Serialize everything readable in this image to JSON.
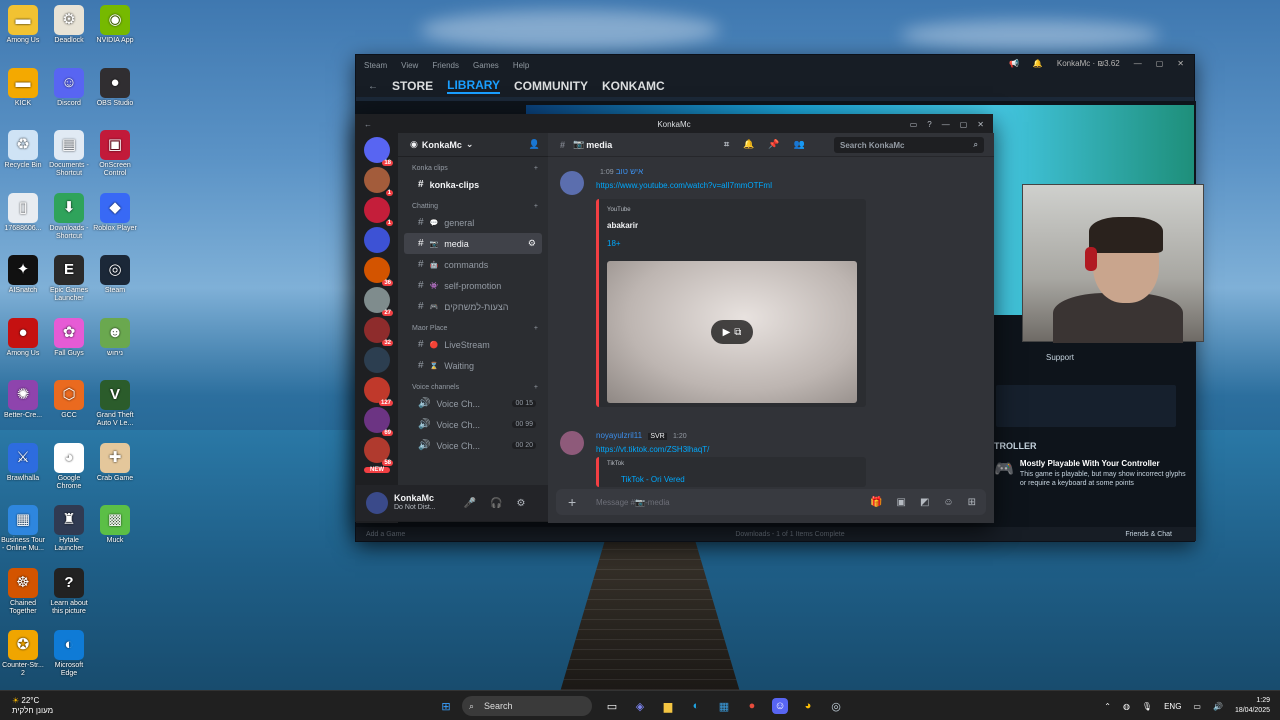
{
  "desktop": {
    "icons": [
      {
        "label": "Among Us",
        "color": "#f1c232",
        "glyph": "▬",
        "col": 0,
        "row": 0
      },
      {
        "label": "Deadlock",
        "color": "#e8e3d6",
        "glyph": "⚙",
        "col": 1,
        "row": 0
      },
      {
        "label": "NVIDIA App",
        "color": "#76b900",
        "glyph": "◉",
        "col": 2,
        "row": 0
      },
      {
        "label": "KICK",
        "color": "#f4a900",
        "glyph": "▬",
        "col": 0,
        "row": 1
      },
      {
        "label": "Discord",
        "color": "#5865f2",
        "glyph": "☺",
        "col": 1,
        "row": 1
      },
      {
        "label": "OBS Studio",
        "color": "#302e31",
        "glyph": "●",
        "col": 2,
        "row": 1
      },
      {
        "label": "Recycle Bin",
        "color": "#cfe3f5",
        "glyph": "♻",
        "col": 0,
        "row": 2
      },
      {
        "label": "Documents - Shortcut",
        "color": "#e1eaf4",
        "glyph": "▤",
        "col": 1,
        "row": 2
      },
      {
        "label": "OnScreen Control",
        "color": "#c21a3a",
        "glyph": "▣",
        "col": 2,
        "row": 2
      },
      {
        "label": "17688606...",
        "color": "#e8ecf1",
        "glyph": "▯",
        "col": 0,
        "row": 3
      },
      {
        "label": "Downloads - Shortcut",
        "color": "#2fa35b",
        "glyph": "⬇",
        "col": 1,
        "row": 3
      },
      {
        "label": "Roblox Player",
        "color": "#3869f5",
        "glyph": "◆",
        "col": 2,
        "row": 3
      },
      {
        "label": "AISnatch",
        "color": "#111111",
        "glyph": "✦",
        "col": 0,
        "row": 4
      },
      {
        "label": "Epic Games Launcher",
        "color": "#2a2a2a",
        "glyph": "E",
        "col": 1,
        "row": 4
      },
      {
        "label": "Steam",
        "color": "#1b2838",
        "glyph": "◎",
        "col": 2,
        "row": 4
      },
      {
        "label": "Among Us",
        "color": "#c51111",
        "glyph": "●",
        "col": 0,
        "row": 5
      },
      {
        "label": "Fall Guys",
        "color": "#e65bd5",
        "glyph": "✿",
        "col": 1,
        "row": 5
      },
      {
        "label": "ניחוש",
        "color": "#6aa84f",
        "glyph": "☻",
        "col": 2,
        "row": 5
      },
      {
        "label": "Better-Cre...",
        "color": "#8e44ad",
        "glyph": "✺",
        "col": 0,
        "row": 6
      },
      {
        "label": "GCC",
        "color": "#ea6a1f",
        "glyph": "⬡",
        "col": 1,
        "row": 6
      },
      {
        "label": "Grand Theft Auto V Le...",
        "color": "#2b5c2b",
        "glyph": "V",
        "col": 2,
        "row": 6
      },
      {
        "label": "Brawlhalla",
        "color": "#2d6cdf",
        "glyph": "⚔",
        "col": 0,
        "row": 7
      },
      {
        "label": "Google Chrome",
        "color": "#ffffff",
        "glyph": "◕",
        "col": 1,
        "row": 7
      },
      {
        "label": "Crab Game",
        "color": "#e4c79b",
        "glyph": "✚",
        "col": 2,
        "row": 7
      },
      {
        "label": "Business Tour - Online Mu...",
        "color": "#2e86de",
        "glyph": "▦",
        "col": 0,
        "row": 8
      },
      {
        "label": "Hytale Launcher",
        "color": "#303a52",
        "glyph": "♜",
        "col": 1,
        "row": 8
      },
      {
        "label": "Muck",
        "color": "#5bbf46",
        "glyph": "▩",
        "col": 2,
        "row": 8
      },
      {
        "label": "Chained Together",
        "color": "#d35400",
        "glyph": "☸",
        "col": 0,
        "row": 9
      },
      {
        "label": "Learn about this picture",
        "color": "#222222",
        "glyph": "?",
        "col": 1,
        "row": 9
      },
      {
        "label": "Counter-Str... 2",
        "color": "#f0a500",
        "glyph": "✪",
        "col": 0,
        "row": 10
      },
      {
        "label": "Microsoft Edge",
        "color": "#0f7bd6",
        "glyph": "◐",
        "col": 1,
        "row": 10
      }
    ]
  },
  "steam": {
    "menu": [
      "Steam",
      "View",
      "Friends",
      "Games",
      "Help"
    ],
    "nav": [
      "STORE",
      "LIBRARY",
      "COMMUNITY",
      "KONKAMC"
    ],
    "active_nav": "LIBRARY",
    "account": "KonkaMc",
    "balance": "₪3.62",
    "support": "Support",
    "controller_header": "TROLLER",
    "controller_title": "Mostly Playable With Your Controller",
    "controller_desc": "This game is playable, but may show incorrect glyphs or require a keyboard at some points",
    "add_game": "Add a Game",
    "downloads": "Downloads - 1 of 1 Items Complete",
    "friends_chat": "Friends & Chat"
  },
  "discord": {
    "title": "KonkaMc",
    "server_name": "KonkaMc",
    "servers": [
      {
        "color": "#5865f2",
        "badge": "18"
      },
      {
        "color": "#a35c3b",
        "badge": "1"
      },
      {
        "color": "#c41e3a",
        "badge": "1"
      },
      {
        "color": "#3d52d5",
        "badge": ""
      },
      {
        "color": "#d35400",
        "badge": "36"
      },
      {
        "color": "#7f8c8d",
        "badge": "27"
      },
      {
        "color": "#8e2c2c",
        "badge": "32"
      },
      {
        "color": "#2c3e50",
        "badge": ""
      },
      {
        "color": "#c0392b",
        "badge": "127"
      },
      {
        "color": "#6c3483",
        "badge": "69"
      },
      {
        "color": "#b03a2e",
        "badge": "58"
      }
    ],
    "new_badge": "NEW",
    "categories": [
      {
        "name": "Konka clips",
        "channels": [
          {
            "name": "konka-clips",
            "style": "bold",
            "emoji": ""
          }
        ]
      },
      {
        "name": "Chatting",
        "channels": [
          {
            "name": "general",
            "style": "",
            "emoji": "💬"
          },
          {
            "name": "media",
            "style": "sel",
            "emoji": "📷"
          },
          {
            "name": "commands",
            "style": "",
            "emoji": "🤖"
          },
          {
            "name": "self-promotion",
            "style": "",
            "emoji": "👾"
          },
          {
            "name": "הצעות-למשחקים",
            "style": "",
            "emoji": "🎮"
          }
        ]
      },
      {
        "name": "Maor Place",
        "channels": [
          {
            "name": "LiveStream",
            "style": "",
            "emoji": "🔴"
          },
          {
            "name": "Waiting",
            "style": "",
            "emoji": "⌛"
          }
        ]
      },
      {
        "name": "Voice channels",
        "channels": [
          {
            "name": "Voice Ch...",
            "style": "",
            "emoji": "🔊",
            "count": "00 15"
          },
          {
            "name": "Voice Ch...",
            "style": "",
            "emoji": "🔊",
            "count": "00 99"
          },
          {
            "name": "Voice Ch...",
            "style": "",
            "emoji": "🔊",
            "count": "00 20"
          }
        ]
      }
    ],
    "user": {
      "name": "KonkaMc",
      "status": "Do Not Dist..."
    },
    "channel_title": "media",
    "search_placeholder": "Search KonkaMc",
    "messages": [
      {
        "author": "איש טוב",
        "time": "1:09",
        "link": "https://www.youtube.com/watch?v=alI7mmOTFmI",
        "embed": {
          "provider": "YouTube",
          "title": "abakarir",
          "tag": "18+"
        }
      },
      {
        "author": "noyayulzril11",
        "tag": "SVR",
        "time": "1:20",
        "link": "https://vt.tiktok.com/ZSH3lhaqT/",
        "embed": {
          "provider": "TikTok",
          "title": "TikTok - Ori Vered"
        }
      }
    ],
    "composer_placeholder": "Message #📷-media"
  },
  "taskbar": {
    "temp": "22°C",
    "weather_text": "מעונן חלקית",
    "search": "Search",
    "lang": "ENG",
    "time": "1:29",
    "date": "18/04/2025"
  }
}
